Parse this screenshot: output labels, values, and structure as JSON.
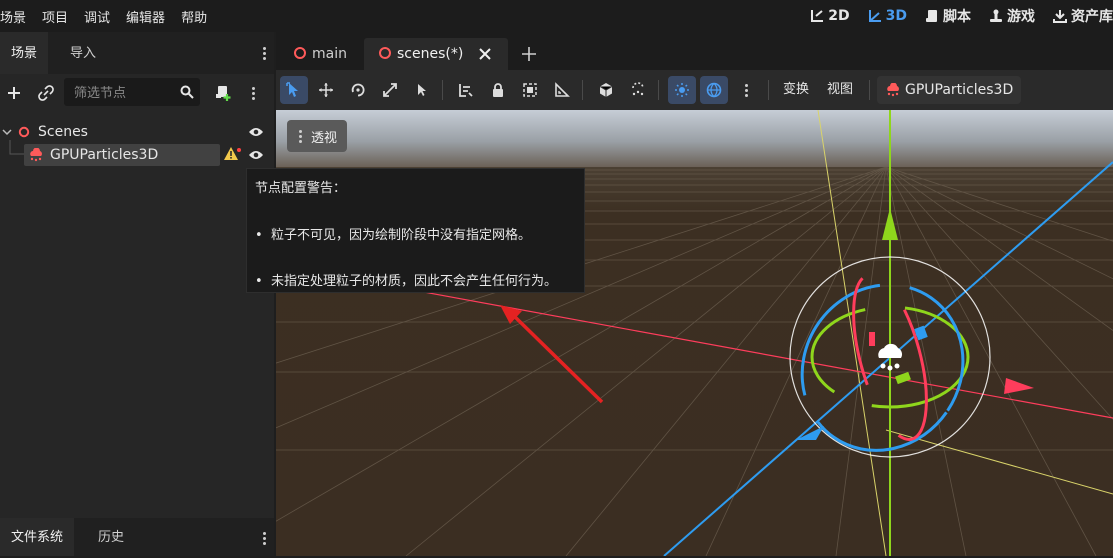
{
  "menu": [
    "场景",
    "项目",
    "调试",
    "编辑器",
    "帮助"
  ],
  "modes": [
    {
      "label": "2D",
      "icon": "2d-icon",
      "active": false
    },
    {
      "label": "3D",
      "icon": "3d-icon",
      "active": true
    },
    {
      "label": "脚本",
      "icon": "script-icon",
      "active": false
    },
    {
      "label": "游戏",
      "icon": "game-icon",
      "active": false
    },
    {
      "label": "资产库",
      "icon": "asset-library-icon",
      "active": false
    }
  ],
  "scene_dock": {
    "tabs": [
      "场景",
      "导入"
    ],
    "filter_placeholder": "筛选节点",
    "tree": [
      {
        "label": "Scenes",
        "icon": "node3d-icon",
        "expanded": true
      },
      {
        "label": "GPUParticles3D",
        "icon": "gpu-particles-icon",
        "selected": true,
        "warning": true
      }
    ]
  },
  "bottom_dock": {
    "tabs": [
      "文件系统",
      "历史"
    ]
  },
  "editor_tabs": [
    "main",
    "scenes(*)"
  ],
  "toolbar": {
    "transform": "变换",
    "view": "视图",
    "node": "GPUParticles3D"
  },
  "viewport": {
    "perspective": "透视"
  },
  "tooltip": {
    "title": "节点配置警告：",
    "items": [
      "粒子不可见，因为绘制阶段中没有指定网格。",
      "未指定处理粒子的材质，因此不会产生任何行为。"
    ]
  },
  "colors": {
    "accent": "#4a9cf0",
    "x_axis": "#ff3d5c",
    "y_axis": "#8fd61c",
    "z_axis": "#2e9cf0",
    "arrow": "#e52222"
  }
}
